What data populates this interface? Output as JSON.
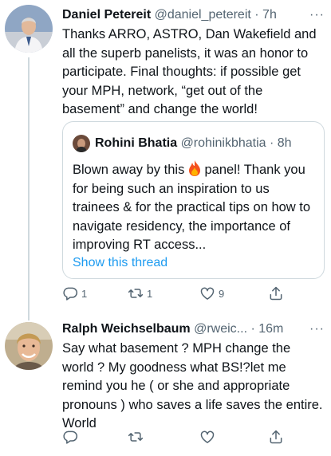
{
  "tweets": [
    {
      "name": "Daniel Petereit",
      "handle": "@daniel_petereit",
      "time": "· 7h",
      "more": "···",
      "text": "Thanks ARRO, ASTRO, Dan Wakefield and all the superb panelists, it was an honor to participate. Final thoughts: if possible get your MPH, network, “get out of the basement” and change the world!",
      "quote": {
        "name": "Rohini Bhatia",
        "handle": "@rohinikbhatia",
        "time": "· 8h",
        "text_before": "Blown away by this ",
        "emoji": "fire",
        "text_after": " panel! Thank you for being such an inspiration to us trainees & for the practical tips on how to navigate residency, the importance of improving RT access...",
        "link": "Show this thread"
      },
      "actions": {
        "reply_icon": "reply-icon",
        "reply_count": "1",
        "retweet_icon": "retweet-icon",
        "retweet_count": "1",
        "like_icon": "heart-icon",
        "like_count": "9",
        "share_icon": "share-icon"
      }
    },
    {
      "name": "Ralph Weichselbaum",
      "handle": "@rweic...",
      "time": "· 16m",
      "more": "···",
      "text": "Say what basement ? MPH change the world ? My goodness what BS!?let me remind you he ( or she and appropriate pronouns ) who saves a life saves the entire. World",
      "actions": {
        "reply_icon": "reply-icon",
        "reply_count": "",
        "retweet_icon": "retweet-icon",
        "retweet_count": "",
        "like_icon": "heart-icon",
        "like_count": "",
        "share_icon": "share-icon"
      }
    }
  ],
  "colors": {
    "text": "#0f1419",
    "secondary": "#536471",
    "link": "#1d9bf0",
    "border": "#cfd9de"
  }
}
